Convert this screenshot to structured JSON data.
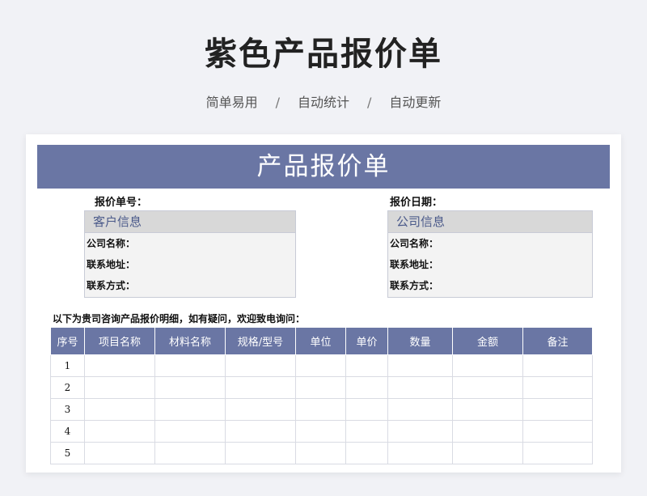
{
  "header": {
    "title": "紫色产品报价单",
    "tags": [
      "简单易用",
      "自动统计",
      "自动更新"
    ],
    "separator": "/"
  },
  "sheet": {
    "banner_title": "产品报价单",
    "quote_no_label": "报价单号：",
    "quote_date_label": "报价日期：",
    "customer_box": {
      "title": "客户信息",
      "fields": [
        "公司名称：",
        "联系地址：",
        "联系方式："
      ]
    },
    "company_box": {
      "title": "公司信息",
      "fields": [
        "公司名称：",
        "联系地址：",
        "联系方式："
      ]
    },
    "note": "以下为贵司咨询产品报价明细，如有疑问，欢迎致电询问：",
    "table": {
      "headers": [
        "序号",
        "项目名称",
        "材料名称",
        "规格/型号",
        "单位",
        "单价",
        "数量",
        "金额",
        "备注"
      ],
      "rows": [
        "1",
        "2",
        "3",
        "4",
        "5"
      ]
    }
  },
  "colors": {
    "accent": "#6a76a4",
    "info_header_bg": "#d8d8d8",
    "info_title_text": "#4b5a8a",
    "page_bg": "#f1f2f6"
  }
}
